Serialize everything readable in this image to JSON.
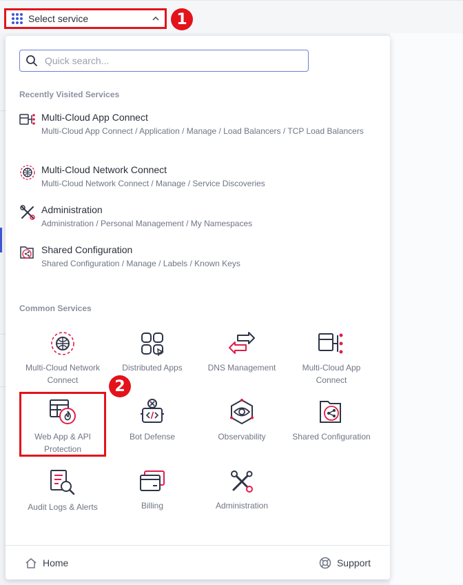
{
  "colors": {
    "accent": "#3b57d4",
    "highlight": "#e3131b",
    "icon_red": "#e11d48",
    "icon_dark": "#2f3447"
  },
  "top_select": {
    "label": "Select service",
    "icon": "grid-icon",
    "chevron": "^"
  },
  "annotations": {
    "step1": "1",
    "step2": "2"
  },
  "search": {
    "placeholder": "Quick search..."
  },
  "recent": {
    "title": "Recently Visited Services",
    "items": [
      {
        "title": "Multi-Cloud App Connect",
        "path": "Multi-Cloud App Connect / Application / Manage / Load Balancers / TCP Load Balancers",
        "icon": "app-connect-icon"
      },
      {
        "title": "Multi-Cloud Network Connect",
        "path": "Multi-Cloud Network Connect / Manage / Service Discoveries",
        "icon": "network-connect-icon"
      },
      {
        "title": "Administration",
        "path": "Administration / Personal Management / My Namespaces",
        "icon": "administration-icon"
      },
      {
        "title": "Shared Configuration",
        "path": "Shared Configuration / Manage / Labels / Known Keys",
        "icon": "shared-config-icon"
      }
    ]
  },
  "common": {
    "title": "Common Services",
    "tiles": [
      {
        "label": "Multi-Cloud Network Connect",
        "icon": "network-connect-icon"
      },
      {
        "label": "Distributed Apps",
        "icon": "distributed-apps-icon"
      },
      {
        "label": "DNS Management",
        "icon": "dns-icon"
      },
      {
        "label": "Multi-Cloud App Connect",
        "icon": "app-connect-icon"
      },
      {
        "label": "Web App & API Protection",
        "icon": "waap-icon"
      },
      {
        "label": "Bot Defense",
        "icon": "bot-defense-icon"
      },
      {
        "label": "Observability",
        "icon": "observability-icon"
      },
      {
        "label": "Shared Configuration",
        "icon": "shared-config-icon"
      },
      {
        "label": "Audit Logs & Alerts",
        "icon": "audit-logs-icon"
      },
      {
        "label": "Billing",
        "icon": "billing-icon"
      },
      {
        "label": "Administration",
        "icon": "administration-icon"
      }
    ]
  },
  "footer": {
    "home": "Home",
    "support": "Support",
    "home_icon": "home-icon",
    "support_icon": "lifebuoy-icon"
  }
}
